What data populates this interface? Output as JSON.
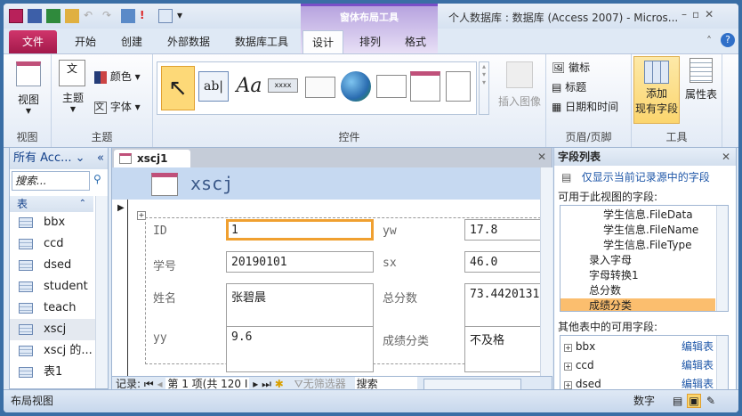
{
  "window": {
    "title": "个人数据库 : 数据库 (Access 2007)  -  Micros...",
    "context_tab_group": "窗体布局工具"
  },
  "ribbon_tabs": [
    "文件",
    "开始",
    "创建",
    "外部数据",
    "数据库工具",
    "设计",
    "排列",
    "格式"
  ],
  "active_tab": "设计",
  "ribbon": {
    "groups": {
      "view": "视图",
      "theme": "主题",
      "controls": "控件",
      "header_footer": "页眉/页脚",
      "tools": "工具"
    },
    "view_button": "视图",
    "theme_button": "主题",
    "colors_button": "颜色",
    "fonts_button": "字体",
    "insert_image": "插入图像",
    "logo": "徽标",
    "title": "标题",
    "datetime": "日期和时间",
    "add_existing_fields": [
      "添加",
      "现有字段"
    ],
    "property_sheet": "属性表",
    "gallery_text_box": "ab|",
    "gallery_label": "Aa",
    "gallery_button": "xxxx"
  },
  "nav_pane": {
    "title": "所有 Acc...",
    "search_placeholder": "搜索...",
    "section": "表",
    "items": [
      "bbx",
      "ccd",
      "dsed",
      "student",
      "teach",
      "xscj",
      "xscj 的...",
      "表1"
    ],
    "selected": "xscj"
  },
  "document": {
    "tab": "xscj1",
    "form_title": "xscj",
    "fields": [
      {
        "label": "ID",
        "value": "1"
      },
      {
        "label": "学号",
        "value": "20190101"
      },
      {
        "label": "姓名",
        "value": "张碧晨"
      },
      {
        "label": "yy",
        "value": "9.6"
      },
      {
        "label": "yw",
        "value": "17.8"
      },
      {
        "label": "sx",
        "value": "46.0"
      },
      {
        "label": "总分数",
        "value": "73.4420131"
      },
      {
        "label": "成绩分类",
        "value": "不及格"
      }
    ],
    "record_nav": {
      "label": "记录:",
      "position": "第 1 项(共 120 I",
      "filter": "无筛选器",
      "search": "搜索"
    }
  },
  "field_list": {
    "title": "字段列表",
    "show_only": "仅显示当前记录源中的字段",
    "available_label": "可用于此视图的字段:",
    "available": [
      {
        "name": "学生信息.FileData",
        "indent": 2
      },
      {
        "name": "学生信息.FileName",
        "indent": 2
      },
      {
        "name": "学生信息.FileType",
        "indent": 2
      },
      {
        "name": "录入字母",
        "indent": 1
      },
      {
        "name": "字母转换1",
        "indent": 1
      },
      {
        "name": "总分数",
        "indent": 1
      },
      {
        "name": "成绩分类",
        "indent": 1
      }
    ],
    "selected": "成绩分类",
    "other_label": "其他表中的可用字段:",
    "other": [
      "bbx",
      "ccd",
      "dsed"
    ],
    "edit_table": "编辑表"
  },
  "status_bar": {
    "left": "布局视图",
    "numlock": "数字"
  },
  "colors": {
    "file_tab": "#b8215a",
    "selection": "#fbbe6e",
    "focus_border": "#f0a030",
    "link": "#1f57a8"
  }
}
